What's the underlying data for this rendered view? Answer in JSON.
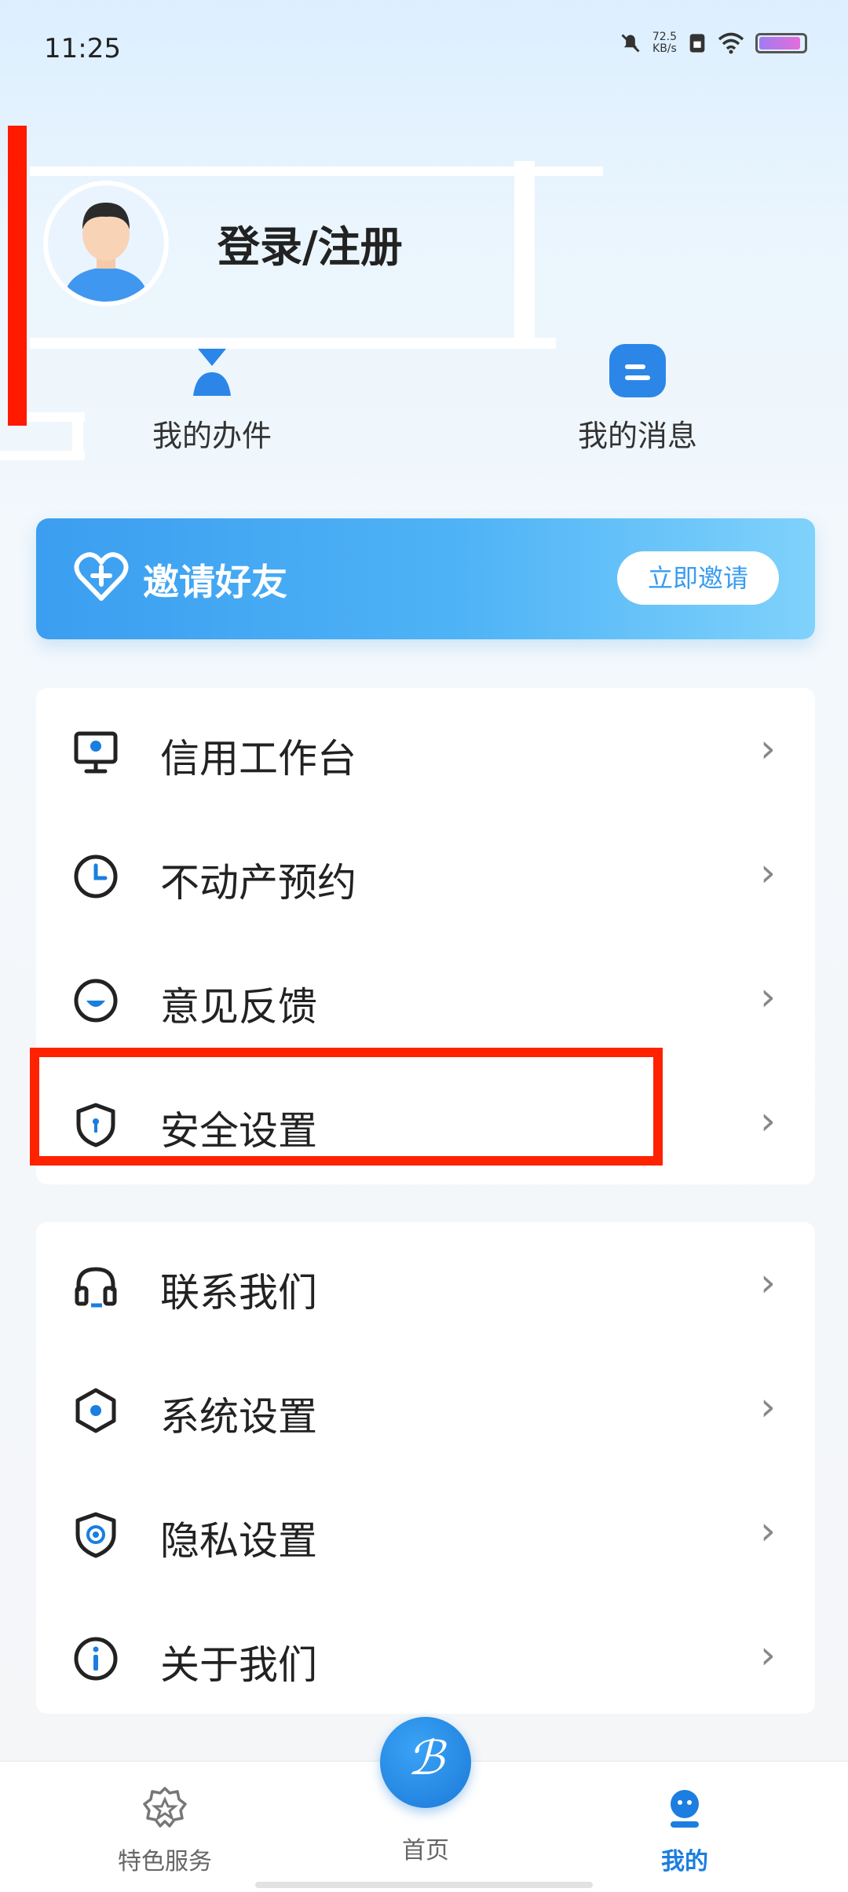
{
  "status": {
    "time": "11:25",
    "net_speed_value": "72.5",
    "net_speed_unit": "KB/s"
  },
  "profile": {
    "login_label": "登录/注册"
  },
  "quick": [
    {
      "label": "我的办件",
      "icon": "user-tasks-icon"
    },
    {
      "label": "我的消息",
      "icon": "message-icon"
    }
  ],
  "invite": {
    "title": "邀请好友",
    "button": "立即邀请"
  },
  "menu_group_1": [
    {
      "label": "信用工作台",
      "icon": "monitor-icon"
    },
    {
      "label": "不动产预约",
      "icon": "clock-icon"
    },
    {
      "label": "意见反馈",
      "icon": "feedback-icon"
    },
    {
      "label": "安全设置",
      "icon": "shield-lock-icon"
    }
  ],
  "menu_group_2": [
    {
      "label": "联系我们",
      "icon": "headset-icon"
    },
    {
      "label": "系统设置",
      "icon": "hex-settings-icon"
    },
    {
      "label": "隐私设置",
      "icon": "privacy-shield-icon"
    },
    {
      "label": "关于我们",
      "icon": "info-icon"
    }
  ],
  "tabs": [
    {
      "label": "特色服务",
      "icon": "badge-icon"
    },
    {
      "label": "首页",
      "icon": "home-logo-icon"
    },
    {
      "label": "我的",
      "icon": "profile-icon"
    }
  ],
  "colors": {
    "accent": "#1b7ee0",
    "highlight": "#ff2200"
  }
}
